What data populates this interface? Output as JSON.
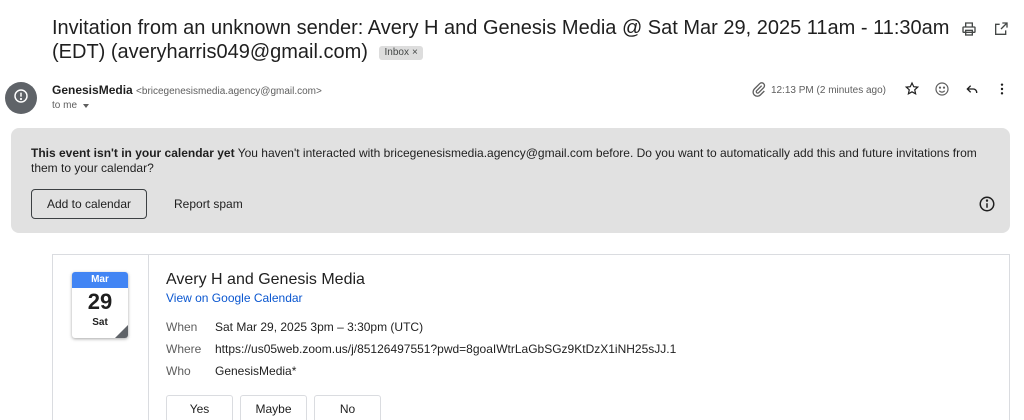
{
  "email": {
    "subject": "Invitation from an unknown sender: Avery H and Genesis Media @ Sat Mar 29, 2025 11am - 11:30am (EDT) (averyharris049@gmail.com)",
    "label_chip": "Inbox",
    "label_chip_close": "×",
    "sender_name": "GenesisMedia",
    "sender_email": "<bricegenesismedia.agency@gmail.com>",
    "to_text": "to me",
    "time": "12:13 PM (2 minutes ago)"
  },
  "icons": {
    "print": "printer-icon",
    "popout": "open-in-new-icon",
    "avatar": "alert-circle-icon",
    "attachment": "paperclip-icon",
    "star": "star-icon",
    "emoji": "emoji-icon",
    "reply": "reply-icon",
    "more": "more-vert-icon",
    "info": "info-icon"
  },
  "banner": {
    "bold_text": "This event isn't in your calendar yet",
    "message": " You haven't interacted with bricegenesismedia.agency@gmail.com before. Do you want to automatically add this and future invitations from them to your calendar?",
    "add_button": "Add to calendar",
    "spam_button": "Report spam"
  },
  "event": {
    "month": "Mar",
    "day": "29",
    "weekday": "Sat",
    "title": "Avery H and Genesis Media",
    "calendar_link": "View on Google Calendar",
    "when_label": "When",
    "when_value": "Sat Mar 29, 2025 3pm – 3:30pm (UTC)",
    "where_label": "Where",
    "where_value": "https://us05web.zoom.us/j/85126497551?pwd=8goaIWtrLaGbSGz9KtDzX1iNH25sJJ.1",
    "who_label": "Who",
    "who_value": "GenesisMedia*",
    "rsvp": [
      "Yes",
      "Maybe",
      "No"
    ]
  },
  "colors": {
    "banner_bg": "#e1e1e1",
    "link": "#0b57d0",
    "calendar_month_bg": "#4285f4",
    "avatar_bg": "#5f6368"
  }
}
